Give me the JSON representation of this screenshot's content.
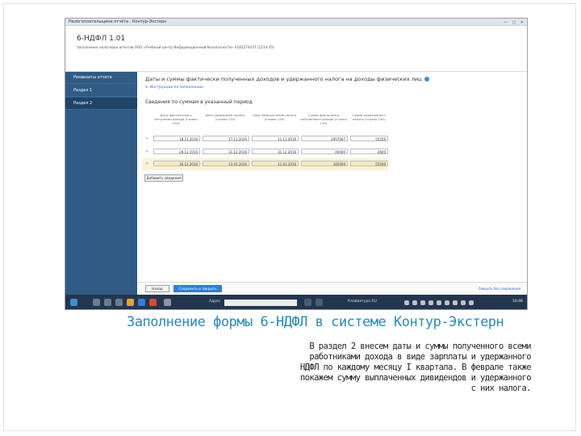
{
  "window": {
    "title": "Налогоплательщики отчёта · Контур-Экстерн",
    "controls": "—  ▢  ✕"
  },
  "form": {
    "title": "6-НДФЛ 1.01",
    "subtitle": "Заполнение налоговых агентов ООО «Учебный центр Информационный безопасности» 6181274437 (1234-35)"
  },
  "sidebar": {
    "items": [
      {
        "label": "Реквизиты отчета",
        "active": false
      },
      {
        "label": "Раздел 1",
        "active": false
      },
      {
        "label": "Раздел 2",
        "active": true
      }
    ]
  },
  "section": {
    "title": "Даты и суммы фактически полученных доходов и удержанного налога на доходы физических лиц",
    "link_label": "Инструкция по заполнению",
    "subtitle": "Сведения по суммам в указанный период"
  },
  "table": {
    "headers": [
      "Дата фактического получения дохода (строка 100)",
      "Дата удержания налога (строка 110)",
      "Срок перечисления налога (строка 120)",
      "Сумма фактически полученного дохода (строка 130)",
      "Сумма удержанного налога (строка 140)"
    ],
    "rows": [
      {
        "mark": "×",
        "cells": [
          "18.11.2016",
          "17.11.2016",
          "11.11.2016",
          "3457007",
          "55556"
        ]
      },
      {
        "mark": "×",
        "cells": [
          "28.12.2016",
          "31.12.2016",
          "31.12.2016",
          "40000",
          "2600"
        ]
      },
      {
        "mark": "×",
        "cells": [
          "30.12.2016",
          "13.01.2016",
          "11.01.2016",
          "345000",
          "55500"
        ]
      }
    ],
    "add_button": "Добавить сведения"
  },
  "footer": {
    "back_label": "Назад",
    "save_label": "Сохранить и закрыть",
    "link_label": "Закрыть без сохранения"
  },
  "taskbar": {
    "search_label": "Адрес",
    "tray_label": "Клавиатура RU",
    "clock": "10:46"
  },
  "slide": {
    "title": "Заполнение формы 6-НДФЛ в системе Контур-Экстерн",
    "body": [
      "В раздел 2 внесем даты и суммы полученного всеми",
      "работниками дохода в виде зарплаты и удержанного",
      "НДФЛ по каждому месяцу I квартала. В феврале также",
      "покажем сумму выплаченных дивидендов и удержанного",
      "с них налога."
    ]
  },
  "colors": {
    "sidebar": "#2f5b85",
    "highlight_row": "#fcf2d8",
    "primary_button": "#2f7fcf",
    "slide_title": "#2b8ab4",
    "taskbar": "#23364d"
  }
}
